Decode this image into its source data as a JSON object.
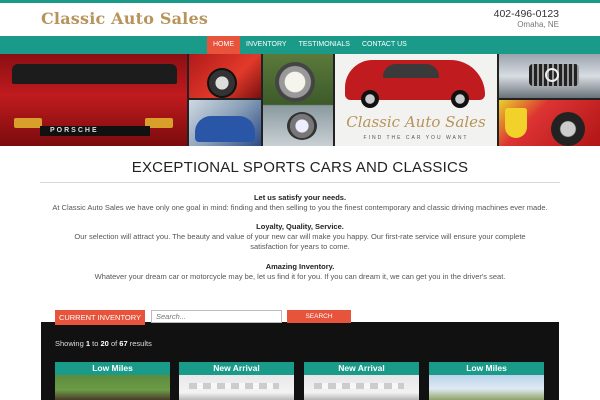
{
  "header": {
    "logo": "Classic Auto Sales",
    "phone": "402-496-0123",
    "city": "Omaha, NE"
  },
  "nav": {
    "items": [
      {
        "label": "HOME",
        "active": true
      },
      {
        "label": "INVENTORY",
        "active": false
      },
      {
        "label": "TESTIMONIALS",
        "active": false
      },
      {
        "label": "CONTACT US",
        "active": false
      }
    ]
  },
  "banner": {
    "plate_word": "PORSCHE",
    "brand": "Classic Auto Sales",
    "tagline": "FIND THE CAR YOU WANT"
  },
  "headline": "EXCEPTIONAL SPORTS CARS AND CLASSICS",
  "sections": [
    {
      "title": "Let us satisfy your needs.",
      "body": "At Classic Auto Sales we have only one goal in mind: finding and then selling to you the finest contemporary and classic driving machines ever made."
    },
    {
      "title": "Loyalty, Quality, Service.",
      "body": "Our selection will attract you. The beauty and value of your new car will make you happy. Our first-rate service will ensure your complete satisfaction for years to come."
    },
    {
      "title": "Amazing Inventory.",
      "body": "Whatever your dream car or motorcycle may be, let us find it for you. If you can dream it, we can get you in the driver's seat."
    }
  ],
  "inventory": {
    "tab_label": "CURRENT INVENTORY",
    "search_placeholder": "Search...",
    "search_button": "SEARCH",
    "results": {
      "prefix": "Showing",
      "from": "1",
      "to_word": "to",
      "to": "20",
      "of_word": "of",
      "total": "67",
      "suffix": "results"
    },
    "cards": [
      {
        "label": "Low Miles"
      },
      {
        "label": "New Arrival"
      },
      {
        "label": "New Arrival"
      },
      {
        "label": "Low Miles"
      }
    ]
  },
  "colors": {
    "teal": "#1a9b8a",
    "orange": "#e8533c",
    "gold": "#b8935a"
  }
}
